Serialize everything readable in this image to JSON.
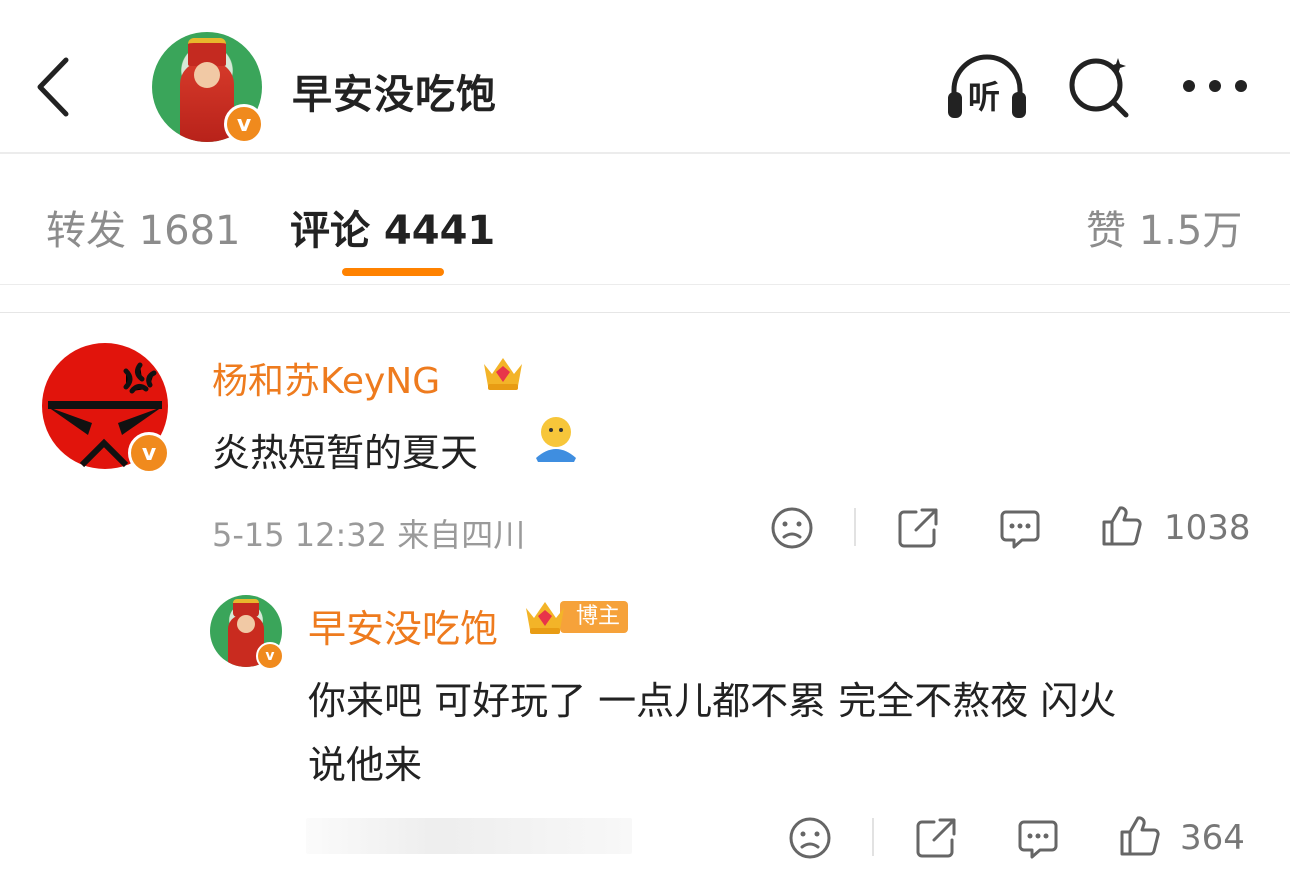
{
  "header": {
    "title": "早安没吃饱",
    "listen_label": "听",
    "icons": [
      "back-icon",
      "listen-headphone-icon",
      "search-icon",
      "more-icon"
    ]
  },
  "tabs": {
    "repost": "转发 1681",
    "comment": "评论 4441",
    "like": "赞 1.5万"
  },
  "comment": {
    "username": "杨和苏KeyNG",
    "text": "炎热短暂的夏天",
    "meta": "5-15 12:32 来自四川",
    "like_count": "1038"
  },
  "reply": {
    "username": "早安没吃饱",
    "blogger_tag": "博主",
    "text_line1": "你来吧 可好玩了 一点儿都不累 完全不熬夜 闪火",
    "text_line2": "说他来",
    "like_count": "364"
  },
  "colors": {
    "accent": "#ff8200",
    "username": "#ee7b1e",
    "verified": "#f08a1d"
  }
}
